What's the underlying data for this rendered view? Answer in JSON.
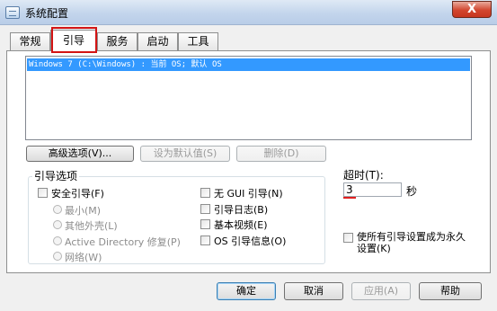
{
  "window": {
    "title": "系统配置",
    "close_glyph": "X"
  },
  "tabs": [
    {
      "label": "常规"
    },
    {
      "label": "引导"
    },
    {
      "label": "服务"
    },
    {
      "label": "启动"
    },
    {
      "label": "工具"
    }
  ],
  "boot": {
    "entries": [
      {
        "text": "Windows 7 (C:\\Windows) : 当前 OS; 默认 OS"
      }
    ],
    "advanced_button": "高级选项(V)...",
    "set_default_button": "设为默认值(S)",
    "delete_button": "删除(D)"
  },
  "boot_options": {
    "title": "引导选项",
    "safe_boot": "安全引导(F)",
    "radios": [
      {
        "label": "最小(M)"
      },
      {
        "label": "其他外壳(L)"
      },
      {
        "label": "Active Directory 修复(P)"
      },
      {
        "label": "网络(W)"
      }
    ],
    "no_gui": "无 GUI 引导(N)",
    "boot_log": "引导日志(B)",
    "base_video": "基本视频(E)",
    "os_boot_info": "OS 引导信息(O)"
  },
  "timeout": {
    "label": "超时(T):",
    "value": "3",
    "unit": "秒"
  },
  "make_permanent": "使所有引导设置成为永久设置(K)",
  "footer": {
    "ok": "确定",
    "cancel": "取消",
    "apply": "应用(A)",
    "help": "帮助"
  },
  "colors": {
    "selection": "#3399ff",
    "highlight": "#d31414"
  }
}
